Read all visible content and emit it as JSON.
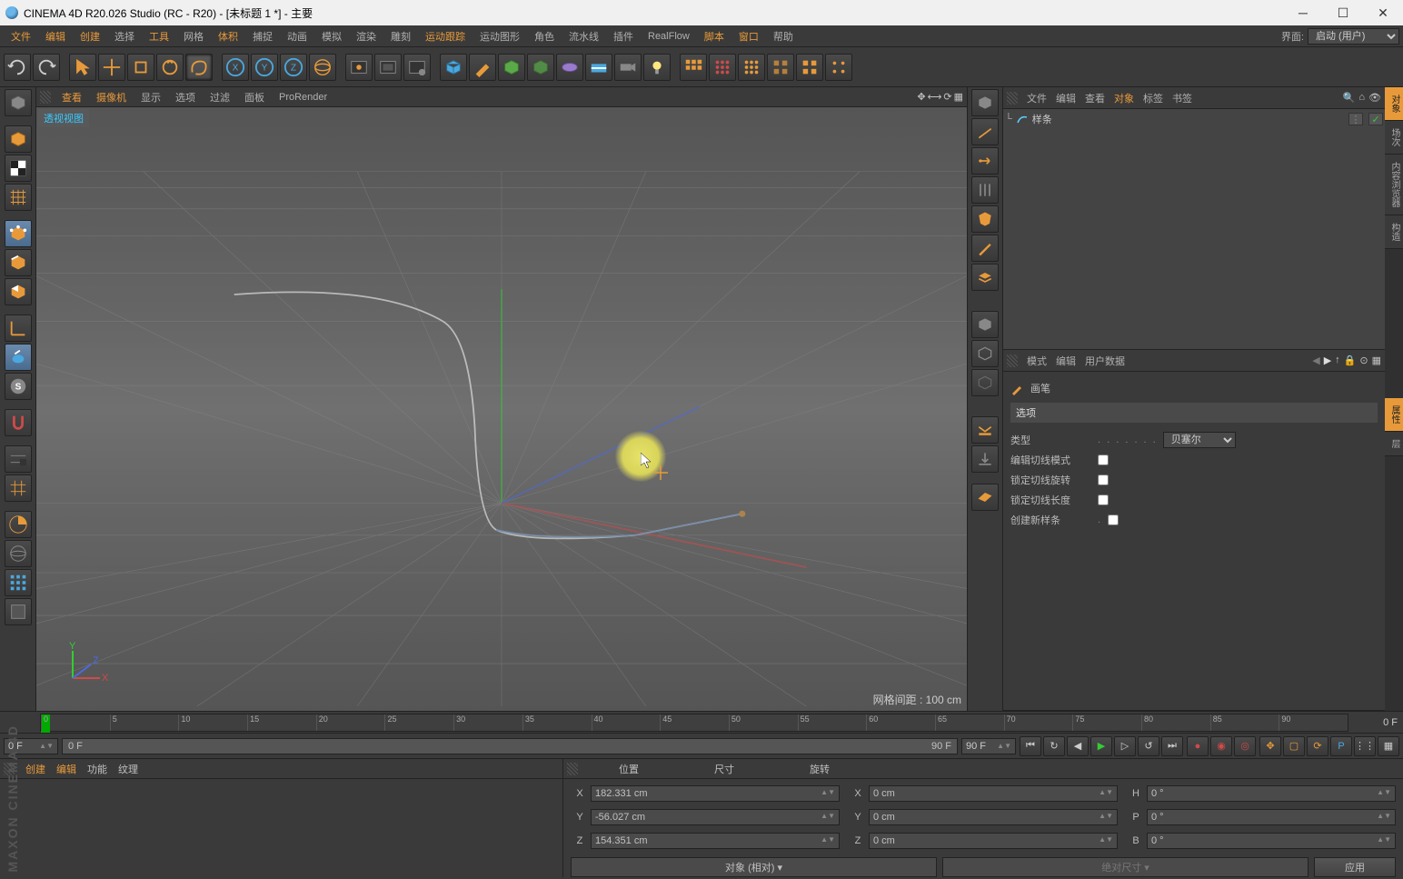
{
  "title": "CINEMA 4D R20.026 Studio (RC - R20) - [未标题 1 *] - 主要",
  "menu": [
    "文件",
    "编辑",
    "创建",
    "选择",
    "工具",
    "网格",
    "体积",
    "捕捉",
    "动画",
    "模拟",
    "渲染",
    "雕刻",
    "运动跟踪",
    "运动图形",
    "角色",
    "流水线",
    "插件",
    "RealFlow",
    "脚本",
    "窗口",
    "帮助"
  ],
  "layout_label": "界面:",
  "layout_value": "启动 (用户)",
  "vp_menu": [
    "查看",
    "摄像机",
    "显示",
    "选项",
    "过滤",
    "面板",
    "ProRender"
  ],
  "vp_title": "透视视图",
  "vp_grid_info": "网格间距 : 100 cm",
  "obj_panel_tabs": [
    "文件",
    "编辑",
    "查看",
    "对象",
    "标签",
    "书签"
  ],
  "obj_item": "样条",
  "attr_panel_tabs": [
    "模式",
    "编辑",
    "用户数据"
  ],
  "attr_tool": "画笔",
  "attr_section": "选项",
  "attr_type_label": "类型",
  "attr_type_value": "贝塞尔",
  "attr_opts": [
    "编辑切线模式",
    "锁定切线旋转",
    "锁定切线长度",
    "创建新样条"
  ],
  "side_tabs_top": [
    "对象",
    "场次",
    "内容浏览器",
    "构造"
  ],
  "side_tabs_bottom": [
    "属性",
    "层"
  ],
  "timeline_end": "0 F",
  "tlticks": [
    "0",
    "5",
    "10",
    "15",
    "20",
    "25",
    "30",
    "35",
    "40",
    "45",
    "50",
    "55",
    "60",
    "65",
    "70",
    "75",
    "80",
    "85",
    "90"
  ],
  "frame_start": "0 F",
  "range_start": "0 F",
  "range_end": "90 F",
  "frame_end": "90 F",
  "bl_tabs": [
    "创建",
    "编辑",
    "功能",
    "纹理"
  ],
  "coord_headers": [
    "位置",
    "尺寸",
    "旋转"
  ],
  "coords": {
    "x_pos": "182.331 cm",
    "y_pos": "-56.027 cm",
    "z_pos": "154.351 cm",
    "x_sz": "0 cm",
    "y_sz": "0 cm",
    "z_sz": "0 cm",
    "h_rot": "0 °",
    "p_rot": "0 °",
    "b_rot": "0 °"
  },
  "coord_mode": "对象 (相对)",
  "coord_size_mode": "绝对尺寸",
  "coord_apply": "应用",
  "logo": "MAXON CINEMA 4D"
}
